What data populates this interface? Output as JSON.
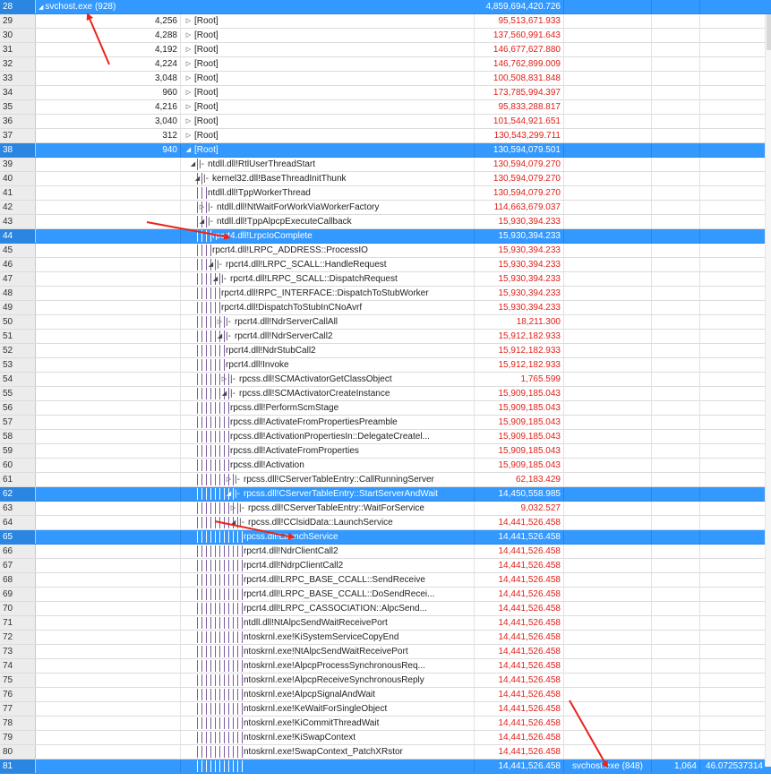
{
  "header_row": {
    "line": "28",
    "process": "svchost.exe (928)",
    "weight": "4,859,694,420.726"
  },
  "rows": [
    {
      "line": "29",
      "count": "4,256",
      "stack": "[Root]",
      "weight": "95,513,671.933",
      "depth": 0,
      "exp": "collapsed",
      "sel": false
    },
    {
      "line": "30",
      "count": "4,288",
      "stack": "[Root]",
      "weight": "137,560,991.643",
      "depth": 0,
      "exp": "collapsed",
      "sel": false
    },
    {
      "line": "31",
      "count": "4,192",
      "stack": "[Root]",
      "weight": "146,677,627.880",
      "depth": 0,
      "exp": "collapsed",
      "sel": false
    },
    {
      "line": "32",
      "count": "4,224",
      "stack": "[Root]",
      "weight": "146,762,899.009",
      "depth": 0,
      "exp": "collapsed",
      "sel": false
    },
    {
      "line": "33",
      "count": "3,048",
      "stack": "[Root]",
      "weight": "100,508,831.848",
      "depth": 0,
      "exp": "collapsed",
      "sel": false
    },
    {
      "line": "34",
      "count": "960",
      "stack": "[Root]",
      "weight": "173,785,994.397",
      "depth": 0,
      "exp": "collapsed",
      "sel": false
    },
    {
      "line": "35",
      "count": "4,216",
      "stack": "[Root]",
      "weight": "95,833,288.817",
      "depth": 0,
      "exp": "collapsed",
      "sel": false
    },
    {
      "line": "36",
      "count": "3,040",
      "stack": "[Root]",
      "weight": "101,544,921.651",
      "depth": 0,
      "exp": "collapsed",
      "sel": false
    },
    {
      "line": "37",
      "count": "312",
      "stack": "[Root]",
      "weight": "130,543,299.711",
      "depth": 0,
      "exp": "collapsed",
      "sel": false
    },
    {
      "line": "38",
      "count": "940",
      "stack": "[Root]",
      "weight": "130,594,079.501",
      "depth": 0,
      "exp": "expanded",
      "sel": true
    },
    {
      "line": "39",
      "count": "",
      "stack": "ntdll.dll!RtlUserThreadStart",
      "weight": "130,594,079.270",
      "depth": 1,
      "exp": "expanded",
      "sel": false
    },
    {
      "line": "40",
      "count": "",
      "stack": "kernel32.dll!BaseThreadInitThunk",
      "weight": "130,594,079.270",
      "depth": 2,
      "exp": "expanded",
      "sel": false
    },
    {
      "line": "41",
      "count": "",
      "stack": "ntdll.dll!TppWorkerThread",
      "weight": "130,594,079.270",
      "depth": 3,
      "exp": "none",
      "sel": false
    },
    {
      "line": "42",
      "count": "",
      "stack": "ntdll.dll!NtWaitForWorkViaWorkerFactory",
      "weight": "114,663,679.037",
      "depth": 3,
      "exp": "collapsed",
      "sel": false
    },
    {
      "line": "43",
      "count": "",
      "stack": "ntdll.dll!TppAlpcpExecuteCallback",
      "weight": "15,930,394.233",
      "depth": 3,
      "exp": "expanded",
      "sel": false
    },
    {
      "line": "44",
      "count": "",
      "stack": "rpcrt4.dll!LrpcIoComplete",
      "weight": "15,930,394.233",
      "depth": 4,
      "exp": "none",
      "sel": true
    },
    {
      "line": "45",
      "count": "",
      "stack": "rpcrt4.dll!LRPC_ADDRESS::ProcessIO",
      "weight": "15,930,394.233",
      "depth": 4,
      "exp": "none",
      "sel": false
    },
    {
      "line": "46",
      "count": "",
      "stack": "rpcrt4.dll!LRPC_SCALL::HandleRequest",
      "weight": "15,930,394.233",
      "depth": 5,
      "exp": "expanded",
      "sel": false
    },
    {
      "line": "47",
      "count": "",
      "stack": "rpcrt4.dll!LRPC_SCALL::DispatchRequest",
      "weight": "15,930,394.233",
      "depth": 6,
      "exp": "expanded",
      "sel": false
    },
    {
      "line": "48",
      "count": "",
      "stack": "rpcrt4.dll!RPC_INTERFACE::DispatchToStubWorker",
      "weight": "15,930,394.233",
      "depth": 6,
      "exp": "none",
      "sel": false
    },
    {
      "line": "49",
      "count": "",
      "stack": "rpcrt4.dll!DispatchToStubInCNoAvrf",
      "weight": "15,930,394.233",
      "depth": 6,
      "exp": "none",
      "sel": false
    },
    {
      "line": "50",
      "count": "",
      "stack": "rpcrt4.dll!NdrServerCallAll",
      "weight": "18,211.300",
      "depth": 7,
      "exp": "collapsed",
      "sel": false
    },
    {
      "line": "51",
      "count": "",
      "stack": "rpcrt4.dll!NdrServerCall2",
      "weight": "15,912,182.933",
      "depth": 7,
      "exp": "expanded",
      "sel": false
    },
    {
      "line": "52",
      "count": "",
      "stack": "rpcrt4.dll!NdrStubCall2",
      "weight": "15,912,182.933",
      "depth": 7,
      "exp": "none",
      "sel": false
    },
    {
      "line": "53",
      "count": "",
      "stack": "rpcrt4.dll!Invoke",
      "weight": "15,912,182.933",
      "depth": 7,
      "exp": "none",
      "sel": false
    },
    {
      "line": "54",
      "count": "",
      "stack": "rpcss.dll!SCMActivatorGetClassObject",
      "weight": "1,765.599",
      "depth": 8,
      "exp": "collapsed",
      "sel": false
    },
    {
      "line": "55",
      "count": "",
      "stack": "rpcss.dll!SCMActivatorCreateInstance",
      "weight": "15,909,185.043",
      "depth": 8,
      "exp": "expanded",
      "sel": false
    },
    {
      "line": "56",
      "count": "",
      "stack": "rpcss.dll!PerformScmStage",
      "weight": "15,909,185.043",
      "depth": 8,
      "exp": "none",
      "sel": false
    },
    {
      "line": "57",
      "count": "",
      "stack": "rpcss.dll!ActivateFromPropertiesPreamble",
      "weight": "15,909,185.043",
      "depth": 8,
      "exp": "none",
      "sel": false
    },
    {
      "line": "58",
      "count": "",
      "stack": "rpcss.dll!ActivationPropertiesIn::DelegateCreatel...",
      "weight": "15,909,185.043",
      "depth": 8,
      "exp": "none",
      "sel": false
    },
    {
      "line": "59",
      "count": "",
      "stack": "rpcss.dll!ActivateFromProperties",
      "weight": "15,909,185.043",
      "depth": 8,
      "exp": "none",
      "sel": false
    },
    {
      "line": "60",
      "count": "",
      "stack": "rpcss.dll!Activation",
      "weight": "15,909,185.043",
      "depth": 8,
      "exp": "none",
      "sel": false
    },
    {
      "line": "61",
      "count": "",
      "stack": "rpcss.dll!CServerTableEntry::CallRunningServer",
      "weight": "62,183.429",
      "depth": 9,
      "exp": "collapsed",
      "sel": false
    },
    {
      "line": "62",
      "count": "",
      "stack": "rpcss.dll!CServerTableEntry::StartServerAndWait",
      "weight": "14,450,558.985",
      "depth": 9,
      "exp": "expanded",
      "sel": true
    },
    {
      "line": "63",
      "count": "",
      "stack": "rpcss.dll!CServerTableEntry::WaitForService",
      "weight": "9,032.527",
      "depth": 10,
      "exp": "collapsed",
      "sel": false
    },
    {
      "line": "64",
      "count": "",
      "stack": "rpcss.dll!CClsidData::LaunchService",
      "weight": "14,441,526.458",
      "depth": 10,
      "exp": "expanded",
      "sel": false
    },
    {
      "line": "65",
      "count": "",
      "stack": "rpcss.dll!LaunchService",
      "weight": "14,441,526.458",
      "depth": 11,
      "exp": "none",
      "sel": true
    },
    {
      "line": "66",
      "count": "",
      "stack": "rpcrt4.dll!NdrClientCall2",
      "weight": "14,441,526.458",
      "depth": 11,
      "exp": "none",
      "sel": false
    },
    {
      "line": "67",
      "count": "",
      "stack": "rpcrt4.dll!NdrpClientCall2",
      "weight": "14,441,526.458",
      "depth": 11,
      "exp": "none",
      "sel": false
    },
    {
      "line": "68",
      "count": "",
      "stack": "rpcrt4.dll!LRPC_BASE_CCALL::SendReceive",
      "weight": "14,441,526.458",
      "depth": 11,
      "exp": "none",
      "sel": false
    },
    {
      "line": "69",
      "count": "",
      "stack": "rpcrt4.dll!LRPC_BASE_CCALL::DoSendRecei...",
      "weight": "14,441,526.458",
      "depth": 11,
      "exp": "none",
      "sel": false
    },
    {
      "line": "70",
      "count": "",
      "stack": "rpcrt4.dll!LRPC_CASSOCIATION::AlpcSend...",
      "weight": "14,441,526.458",
      "depth": 11,
      "exp": "none",
      "sel": false
    },
    {
      "line": "71",
      "count": "",
      "stack": "ntdll.dll!NtAlpcSendWaitReceivePort",
      "weight": "14,441,526.458",
      "depth": 11,
      "exp": "none",
      "sel": false
    },
    {
      "line": "72",
      "count": "",
      "stack": "ntoskrnl.exe!KiSystemServiceCopyEnd",
      "weight": "14,441,526.458",
      "depth": 11,
      "exp": "none",
      "sel": false
    },
    {
      "line": "73",
      "count": "",
      "stack": "ntoskrnl.exe!NtAlpcSendWaitReceivePort",
      "weight": "14,441,526.458",
      "depth": 11,
      "exp": "none",
      "sel": false
    },
    {
      "line": "74",
      "count": "",
      "stack": "ntoskrnl.exe!AlpcpProcessSynchronousReq...",
      "weight": "14,441,526.458",
      "depth": 11,
      "exp": "none",
      "sel": false
    },
    {
      "line": "75",
      "count": "",
      "stack": "ntoskrnl.exe!AlpcpReceiveSynchronousReply",
      "weight": "14,441,526.458",
      "depth": 11,
      "exp": "none",
      "sel": false
    },
    {
      "line": "76",
      "count": "",
      "stack": "ntoskrnl.exe!AlpcpSignalAndWait",
      "weight": "14,441,526.458",
      "depth": 11,
      "exp": "none",
      "sel": false
    },
    {
      "line": "77",
      "count": "",
      "stack": "ntoskrnl.exe!KeWaitForSingleObject",
      "weight": "14,441,526.458",
      "depth": 11,
      "exp": "none",
      "sel": false
    },
    {
      "line": "78",
      "count": "",
      "stack": "ntoskrnl.exe!KiCommitThreadWait",
      "weight": "14,441,526.458",
      "depth": 11,
      "exp": "none",
      "sel": false
    },
    {
      "line": "79",
      "count": "",
      "stack": "ntoskrnl.exe!KiSwapContext",
      "weight": "14,441,526.458",
      "depth": 11,
      "exp": "none",
      "sel": false
    },
    {
      "line": "80",
      "count": "",
      "stack": "ntoskrnl.exe!SwapContext_PatchXRstor",
      "weight": "14,441,526.458",
      "depth": 11,
      "exp": "none",
      "sel": false
    }
  ],
  "footer_row": {
    "line": "81",
    "weight": "14,441,526.458",
    "process": "svchost.exe (848)",
    "count": "1,064",
    "value": "46.072537314"
  },
  "colors": {
    "selection": "#3399ff",
    "weight_text": "#e0201a",
    "tree_guide": "#7a5a9a",
    "annotation_arrow": "#e8241c"
  },
  "annotation_arrows": 4
}
